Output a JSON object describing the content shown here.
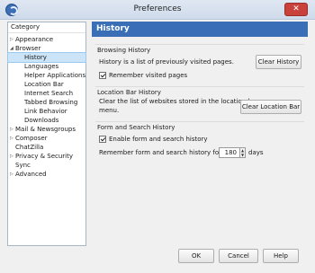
{
  "window": {
    "title": "Preferences",
    "close_label": "✕"
  },
  "nav": {
    "header": "Category",
    "items": [
      {
        "label": "Appearance",
        "level": 0,
        "expander": "▷"
      },
      {
        "label": "Browser",
        "level": 0,
        "expander": "◢"
      },
      {
        "label": "History",
        "level": 1,
        "selected": true
      },
      {
        "label": "Languages",
        "level": 1
      },
      {
        "label": "Helper Applications",
        "level": 1
      },
      {
        "label": "Location Bar",
        "level": 1
      },
      {
        "label": "Internet Search",
        "level": 1
      },
      {
        "label": "Tabbed Browsing",
        "level": 1
      },
      {
        "label": "Link Behavior",
        "level": 1
      },
      {
        "label": "Downloads",
        "level": 1
      },
      {
        "label": "Mail & Newsgroups",
        "level": 0,
        "expander": "▷"
      },
      {
        "label": "Composer",
        "level": 0,
        "expander": "▷"
      },
      {
        "label": "ChatZilla",
        "level": 0
      },
      {
        "label": "Privacy & Security",
        "level": 0,
        "expander": "▷"
      },
      {
        "label": "Sync",
        "level": 0
      },
      {
        "label": "Advanced",
        "level": 0,
        "expander": "▷"
      }
    ]
  },
  "page": {
    "title": "History",
    "browsing": {
      "heading": "Browsing History",
      "description": "History is a list of previously visited pages.",
      "clear_button": "Clear History",
      "remember_label": "Remember visited pages",
      "remember_checked": true
    },
    "location_bar": {
      "heading": "Location Bar History",
      "description_line1": "Clear the list of websites stored in the location bar",
      "description_line2": "menu.",
      "clear_button": "Clear Location Bar"
    },
    "form_search": {
      "heading": "Form and Search History",
      "enable_label": "Enable form and search history",
      "enable_checked": true,
      "remember_prefix": "Remember form and search history for up to",
      "days_value": "180",
      "days_suffix": "days"
    }
  },
  "footer": {
    "ok": "OK",
    "cancel": "Cancel",
    "help": "Help"
  },
  "colors": {
    "accent": "#3a6fb7",
    "selection": "#cce4f7"
  }
}
